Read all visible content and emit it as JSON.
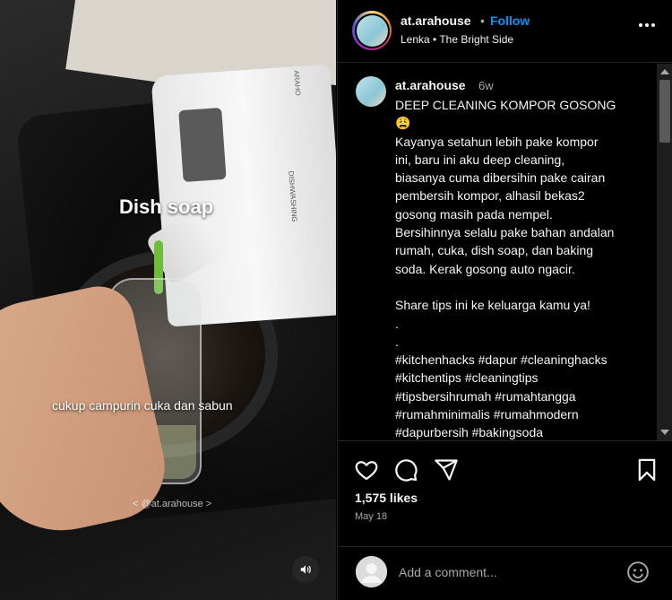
{
  "video": {
    "overlay_title": "Dish soap",
    "overlay_caption": "cukup campurin cuka dan sabun",
    "watermark": "< @at.arahouse >",
    "jug_label": "DISHWASHING",
    "jug_brand": "ARAHO",
    "sound_icon": "speaker-icon"
  },
  "header": {
    "username": "at.arahouse",
    "separator": "•",
    "follow_label": "Follow",
    "audio": "Lenka • The Bright Side",
    "more_icon": "more-options-icon"
  },
  "caption": {
    "username": "at.arahouse",
    "time": "6w",
    "lines": [
      "DEEP CLEANING KOMPOR GOSONG",
      "😩",
      "Kayanya setahun lebih pake kompor",
      "ini, baru ini aku deep cleaning,",
      "biasanya cuma dibersihin pake cairan",
      "pembersih kompor, alhasil bekas2",
      "gosong masih pada nempel.",
      "Bersihinnya selalu pake bahan andalan",
      "rumah, cuka, dish soap, dan baking",
      "soda. Kerak gosong auto ngacir.",
      "",
      "Share tips ini ke keluarga kamu ya!",
      ".",
      ".",
      "#kitchenhacks #dapur #cleaninghacks",
      "#kitchentips #cleaningtips",
      "#tipsbersihrumah #rumahtangga",
      "#rumahminimalis #rumahmodern",
      "#dapurbersih #bakingsoda"
    ]
  },
  "actions": {
    "icons": [
      "heart-icon",
      "comment-icon",
      "share-icon",
      "bookmark-icon"
    ],
    "likes": "1,575 likes",
    "date": "May 18"
  },
  "comment_box": {
    "placeholder": "Add a comment...",
    "emoji_icon": "emoji-icon"
  },
  "colors": {
    "background": "#000000",
    "text": "#f5f5f5",
    "secondary_text": "#a8a8a8",
    "accent": "#0095f6",
    "divider": "#262626"
  }
}
